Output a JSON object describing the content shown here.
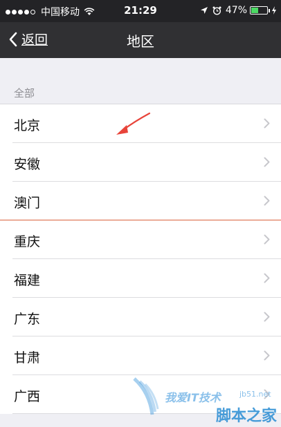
{
  "status_bar": {
    "carrier": "中国移动",
    "time": "21:29",
    "battery_percent": "47%",
    "battery_level": 0.47,
    "icons": [
      "signal-dots",
      "wifi-icon",
      "location-icon",
      "alarm-icon",
      "battery-icon",
      "charging-icon"
    ]
  },
  "nav": {
    "back_label": "返回",
    "title": "地区"
  },
  "section": {
    "header": "全部"
  },
  "regions": [
    {
      "label": "北京"
    },
    {
      "label": "安徽"
    },
    {
      "label": "澳门"
    },
    {
      "label": "重庆"
    },
    {
      "label": "福建"
    },
    {
      "label": "广东"
    },
    {
      "label": "甘肃"
    },
    {
      "label": "广西"
    }
  ],
  "watermark": {
    "site": "我爱IT技术",
    "domain": "jb51.net",
    "brand": "脚本之家"
  },
  "colors": {
    "status_bar_bg": "#232326",
    "nav_bar_bg": "#303033",
    "page_bg": "#efeff4",
    "battery_green": "#4cd964",
    "annotation_red": "#e8443a"
  }
}
